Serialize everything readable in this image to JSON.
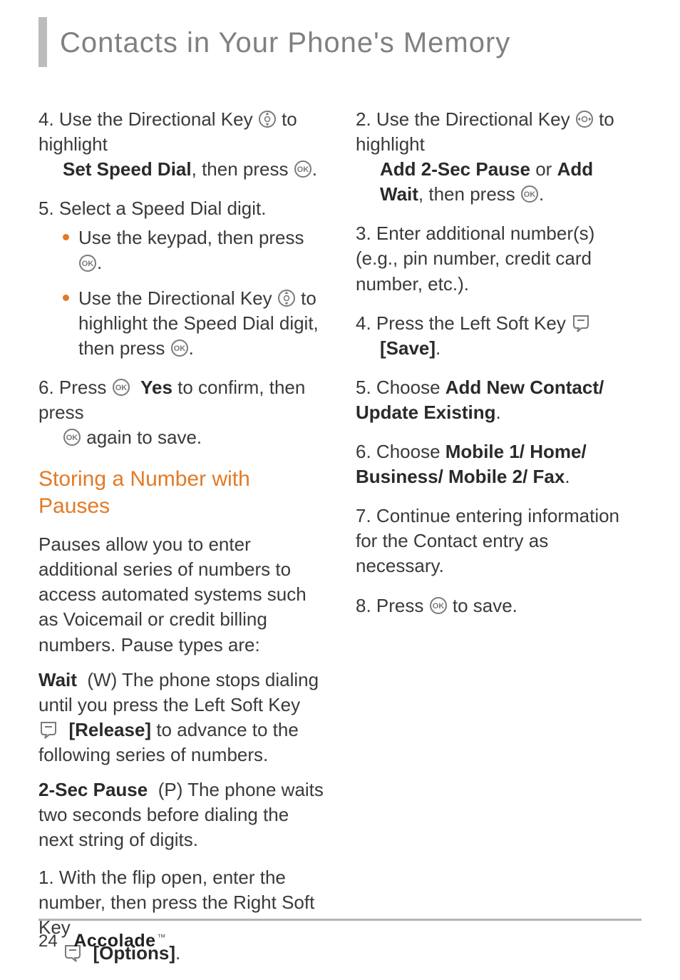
{
  "title": "Contacts in Your Phone's Memory",
  "left": {
    "step4": {
      "num": "4.",
      "t1": "Use the Directional Key ",
      "t2": " to highlight ",
      "bold1": "Set Speed Dial",
      "t3": ", then press ",
      "t4": "."
    },
    "step5": {
      "num": "5.",
      "text": "Select a Speed Dial digit.",
      "b1a": "Use the keypad, then press ",
      "b1b": ".",
      "b2a": "Use the Directional Key ",
      "b2b": " to highlight the Speed Dial digit, then press ",
      "b2c": "."
    },
    "step6": {
      "num": "6.",
      "t1": "Press ",
      "bold1": "Yes",
      "t2": " to confirm, then press ",
      "t3": " again to save."
    },
    "section": "Storing a Number with Pauses",
    "para1": "Pauses allow you to enter additional series of numbers to access automated systems such as Voicemail or credit billing numbers. Pause types are:",
    "wait_label": "Wait",
    "wait_paren": "(W)",
    "wait_text1": " The phone stops dialing until you press the Left Soft Key ",
    "release": "[Release]",
    "wait_text2": " to advance to the following series of numbers.",
    "pause_label": "2-Sec Pause",
    "pause_paren": "(P)",
    "pause_text": " The phone waits two seconds before dialing the next string of digits.",
    "step1": {
      "num": "1.",
      "t1": "With the flip open, enter the number, then press the Right Soft Key ",
      "options": "[Options]",
      "t2": "."
    }
  },
  "right": {
    "step2": {
      "num": "2.",
      "t1": "Use the Directional Key ",
      "t2": " to highlight ",
      "bold1": "Add 2-Sec Pause",
      "t3": " or ",
      "bold2": "Add Wait",
      "t4": ", then press ",
      "t5": "."
    },
    "step3": {
      "num": "3.",
      "text": "Enter additional number(s) (e.g., pin number, credit card number, etc.)."
    },
    "step4": {
      "num": "4.",
      "t1": "Press the Left Soft Key ",
      "save": "[Save]",
      "t2": "."
    },
    "step5": {
      "num": "5.",
      "t1": "Choose ",
      "bold1": "Add New Contact/ Update Existing",
      "t2": "."
    },
    "step6": {
      "num": "6.",
      "t1": "Choose ",
      "bold1": "Mobile 1/ Home/ Business/ Mobile 2/ Fax",
      "t2": "."
    },
    "step7": {
      "num": "7.",
      "text": "Continue entering information for the Contact entry as necessary."
    },
    "step8": {
      "num": "8.",
      "t1": "Press ",
      "t2": " to save."
    }
  },
  "footer": {
    "page_num": "24",
    "brand": "Accolade",
    "tm": "™"
  },
  "icons": {
    "dpad_updown": "dpad-updown-icon",
    "dpad_leftright": "dpad-leftright-icon",
    "ok": "ok-icon",
    "softkey_left": "softkey-left-icon",
    "softkey_right": "softkey-right-icon"
  }
}
